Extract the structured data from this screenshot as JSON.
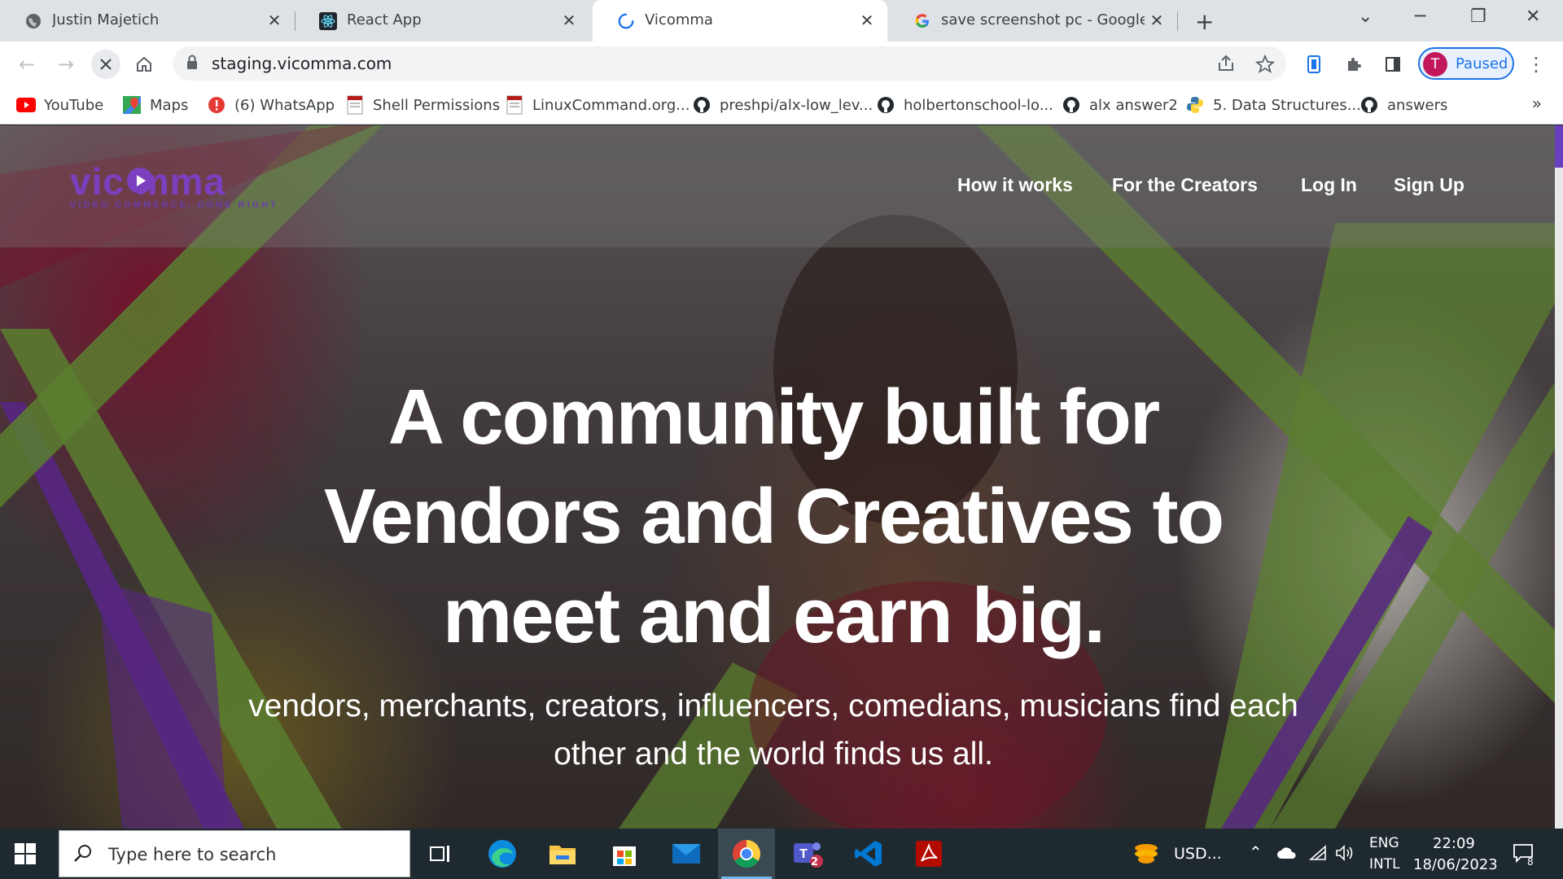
{
  "browser": {
    "tabs": [
      {
        "title": "Justin Majetich",
        "icon": "globe-icon",
        "active": false
      },
      {
        "title": "React App",
        "icon": "react-icon",
        "active": false
      },
      {
        "title": "Vicomma",
        "icon": "loading-spinner-icon",
        "active": true
      },
      {
        "title": "save screenshot pc - Google Sear",
        "icon": "google-icon",
        "active": false
      }
    ],
    "url": "staging.vicomma.com",
    "profile_initial": "T",
    "profile_label": "Paused",
    "bookmarks": [
      {
        "label": "YouTube",
        "icon": "youtube-icon"
      },
      {
        "label": "Maps",
        "icon": "maps-icon"
      },
      {
        "label": "(6) WhatsApp",
        "icon": "whatsapp-icon"
      },
      {
        "label": "Shell Permissions",
        "icon": "page-icon"
      },
      {
        "label": "LinuxCommand.org...",
        "icon": "page-icon"
      },
      {
        "label": "preshpi/alx-low_lev...",
        "icon": "github-icon"
      },
      {
        "label": "holbertonschool-lo...",
        "icon": "github-icon"
      },
      {
        "label": "alx answer2",
        "icon": "github-icon"
      },
      {
        "label": "5. Data Structures...",
        "icon": "python-icon"
      },
      {
        "label": "answers",
        "icon": "github-icon"
      }
    ],
    "bookmarks_more": "»"
  },
  "site": {
    "logo_text": "vic mma",
    "logo_tagline": "VIDEO COMMERCE, DONE RIGHT",
    "nav": [
      {
        "label": "How it works"
      },
      {
        "label": "For the Creators"
      },
      {
        "label": "Log In"
      },
      {
        "label": "Sign Up"
      }
    ],
    "hero_title_line1": "A community built for",
    "hero_title_line2": "Vendors and Creatives to",
    "hero_title_line3": "meet and earn big.",
    "hero_subtitle_line1": "vendors, merchants, creators, influencers, comedians, musicians find each",
    "hero_subtitle_line2": "other and the world finds us all.",
    "accent_color": "#7b3fbf",
    "green_color": "#6f9a3a"
  },
  "taskbar": {
    "search_placeholder": "Type here to search",
    "apps": [
      "task-view-icon",
      "edge-icon",
      "file-explorer-icon",
      "store-icon",
      "mail-icon",
      "chrome-icon",
      "teams-icon",
      "vscode-icon",
      "acrobat-icon"
    ],
    "teams_badge": "2",
    "widget_label": "USD...",
    "lang_line1": "ENG",
    "lang_line2": "INTL",
    "time": "22:09",
    "date": "18/06/2023",
    "notification_count": "8"
  }
}
